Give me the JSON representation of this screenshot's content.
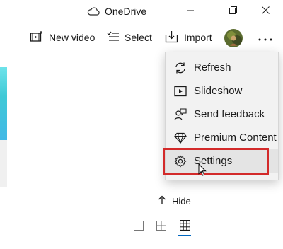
{
  "window": {
    "title": "OneDrive",
    "controls": [
      "minimize",
      "maximize",
      "close"
    ]
  },
  "toolbar": {
    "new_video_label": "New video",
    "select_label": "Select",
    "import_label": "Import",
    "more_icon": "more-icon"
  },
  "menu": {
    "items": [
      {
        "label": "Refresh",
        "icon": "refresh-icon"
      },
      {
        "label": "Slideshow",
        "icon": "slideshow-icon"
      },
      {
        "label": "Send feedback",
        "icon": "feedback-icon"
      },
      {
        "label": "Premium Content",
        "icon": "diamond-icon"
      },
      {
        "label": "Settings",
        "icon": "gear-icon",
        "highlighted": true
      }
    ]
  },
  "bottom": {
    "hide_label": "Hide",
    "view_modes": [
      "single-view",
      "medium-grid-view",
      "small-grid-view"
    ],
    "selected_view": "small-grid-view"
  },
  "colors": {
    "highlight_box": "#d32a2a",
    "accent": "#0067c0",
    "menu_bg": "#f2f2f2"
  }
}
